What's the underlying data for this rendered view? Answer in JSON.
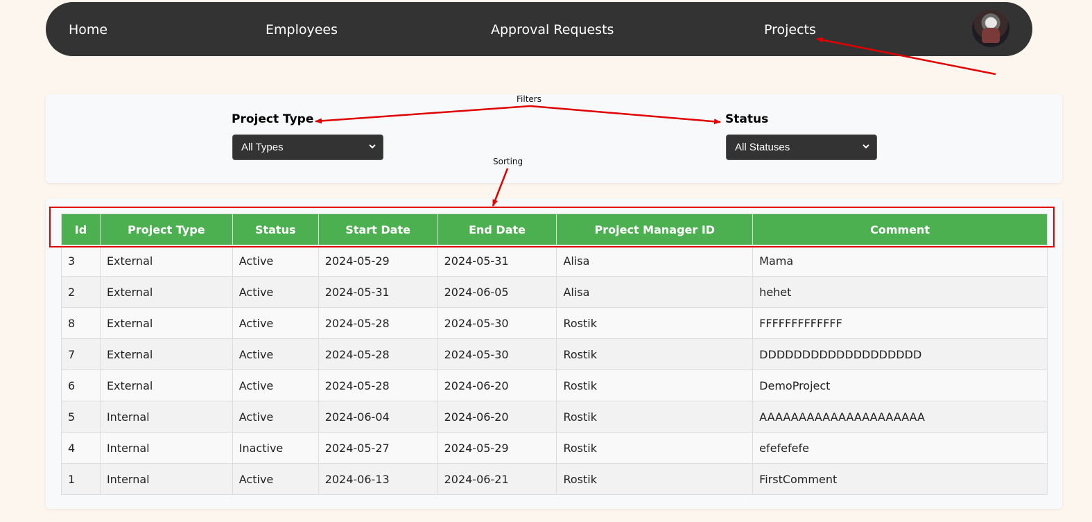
{
  "nav": {
    "home": "Home",
    "employees": "Employees",
    "approval_requests": "Approval Requests",
    "projects": "Projects",
    "avatar_icon": "user-avatar"
  },
  "filters": {
    "project_type": {
      "label": "Project Type",
      "selected": "All Types"
    },
    "status": {
      "label": "Status",
      "selected": "All Statuses"
    }
  },
  "annotations": {
    "filters": "Filters",
    "sorting": "Sorting",
    "color": "#e00000"
  },
  "table": {
    "headers": [
      "Id",
      "Project Type",
      "Status",
      "Start Date",
      "End Date",
      "Project Manager ID",
      "Comment"
    ],
    "rows": [
      [
        "3",
        "External",
        "Active",
        "2024-05-29",
        "2024-05-31",
        "Alisa",
        "Mama"
      ],
      [
        "2",
        "External",
        "Active",
        "2024-05-31",
        "2024-06-05",
        "Alisa",
        "hehet"
      ],
      [
        "8",
        "External",
        "Active",
        "2024-05-28",
        "2024-05-30",
        "Rostik",
        "FFFFFFFFFFFFF"
      ],
      [
        "7",
        "External",
        "Active",
        "2024-05-28",
        "2024-05-30",
        "Rostik",
        "DDDDDDDDDDDDDDDDDDD"
      ],
      [
        "6",
        "External",
        "Active",
        "2024-05-28",
        "2024-06-20",
        "Rostik",
        "DemoProject"
      ],
      [
        "5",
        "Internal",
        "Active",
        "2024-06-04",
        "2024-06-20",
        "Rostik",
        "AAAAAAAAAAAAAAAAAAAAA"
      ],
      [
        "4",
        "Internal",
        "Inactive",
        "2024-05-27",
        "2024-05-29",
        "Rostik",
        "efefefefe"
      ],
      [
        "1",
        "Internal",
        "Active",
        "2024-06-13",
        "2024-06-21",
        "Rostik",
        "FirstComment"
      ]
    ]
  },
  "colors": {
    "navbar": "#333333",
    "page_background": "#fdf6ee",
    "header_green": "#4caf50",
    "select_background": "#333333"
  }
}
